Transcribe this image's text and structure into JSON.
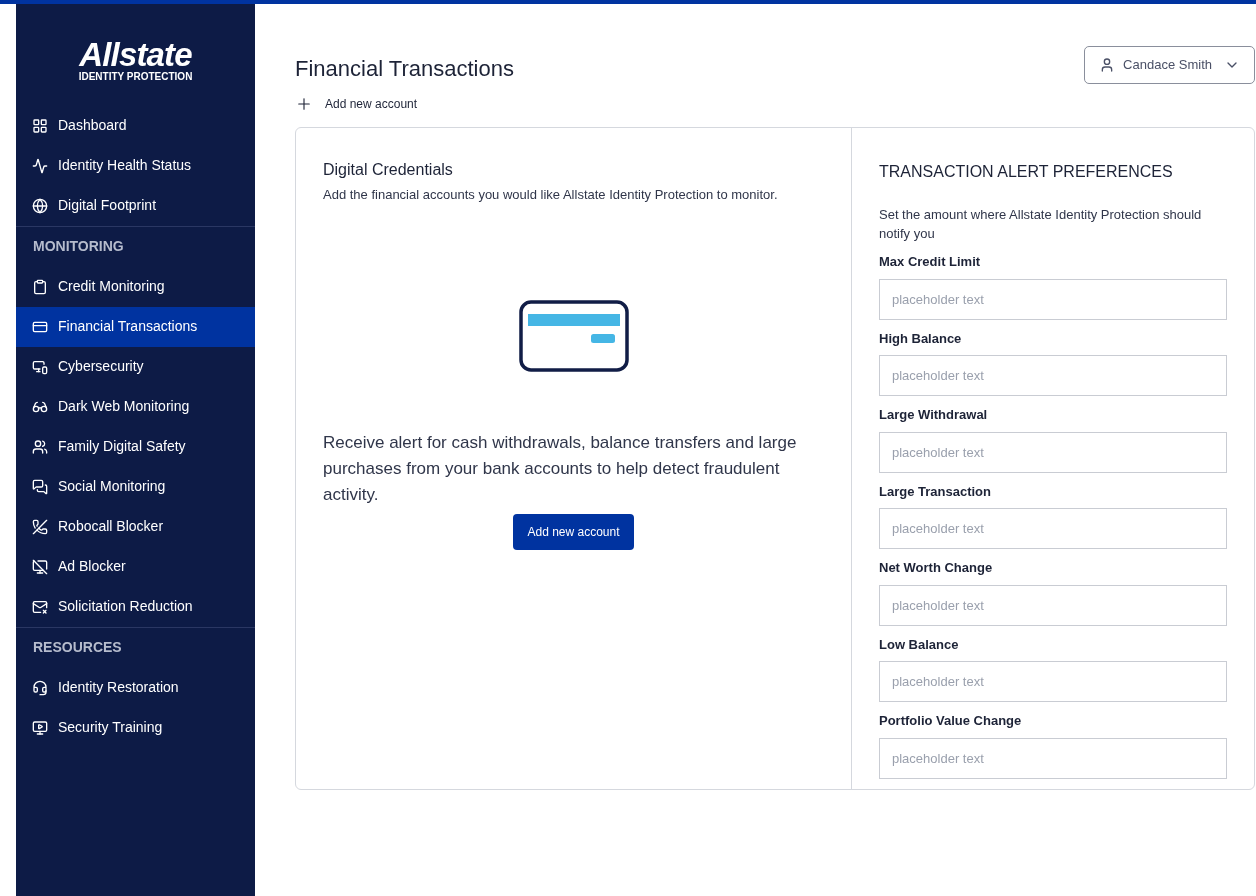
{
  "sidebar": {
    "logo": {
      "name": "Allstate",
      "subtitle": "IDENTITY PROTECTION"
    },
    "groups": [
      {
        "items": [
          {
            "label": "Dashboard",
            "selected": false
          },
          {
            "label": "Identity Health Status",
            "selected": false
          },
          {
            "label": "Digital Footprint",
            "selected": false
          }
        ]
      },
      {
        "heading": "MONITORING",
        "items": [
          {
            "label": "Credit Monitoring",
            "selected": false
          },
          {
            "label": "Financial Transactions",
            "selected": true
          },
          {
            "label": "Cybersecurity",
            "selected": false
          },
          {
            "label": "Dark Web Monitoring",
            "selected": false
          },
          {
            "label": "Family Digital Safety",
            "selected": false
          },
          {
            "label": "Social Monitoring",
            "selected": false
          },
          {
            "label": "Robocall Blocker",
            "selected": false
          },
          {
            "label": "Ad Blocker",
            "selected": false
          },
          {
            "label": "Solicitation Reduction",
            "selected": false
          }
        ]
      },
      {
        "heading": "RESOURCES",
        "items": [
          {
            "label": "Identity Restoration",
            "selected": false
          },
          {
            "label": "Security Training",
            "selected": false
          }
        ]
      }
    ]
  },
  "header": {
    "title": "Financial Transactions",
    "user": "Candace Smith",
    "add_link": "Add new account"
  },
  "credentials": {
    "title": "Digital Credentials",
    "description": "Add the financial accounts you would like Allstate Identity Protection to monitor.",
    "message": "Receive alert for cash withdrawals, balance transfers and large purchases from your bank accounts to help detect fraudulent activity.",
    "button": "Add new account"
  },
  "preferences": {
    "title": "TRANSACTION ALERT PREFERENCES",
    "description": "Set the amount where Allstate Identity Protection should notify you",
    "fields": [
      {
        "label": "Max Credit Limit",
        "placeholder": "placeholder text"
      },
      {
        "label": "High Balance",
        "placeholder": "placeholder text"
      },
      {
        "label": "Large Withdrawal",
        "placeholder": "placeholder text"
      },
      {
        "label": "Large Transaction",
        "placeholder": "placeholder text"
      },
      {
        "label": "Net Worth Change",
        "placeholder": "placeholder text"
      },
      {
        "label": "Low Balance",
        "placeholder": "placeholder text"
      },
      {
        "label": "Portfolio Value Change",
        "placeholder": "placeholder text"
      }
    ]
  }
}
